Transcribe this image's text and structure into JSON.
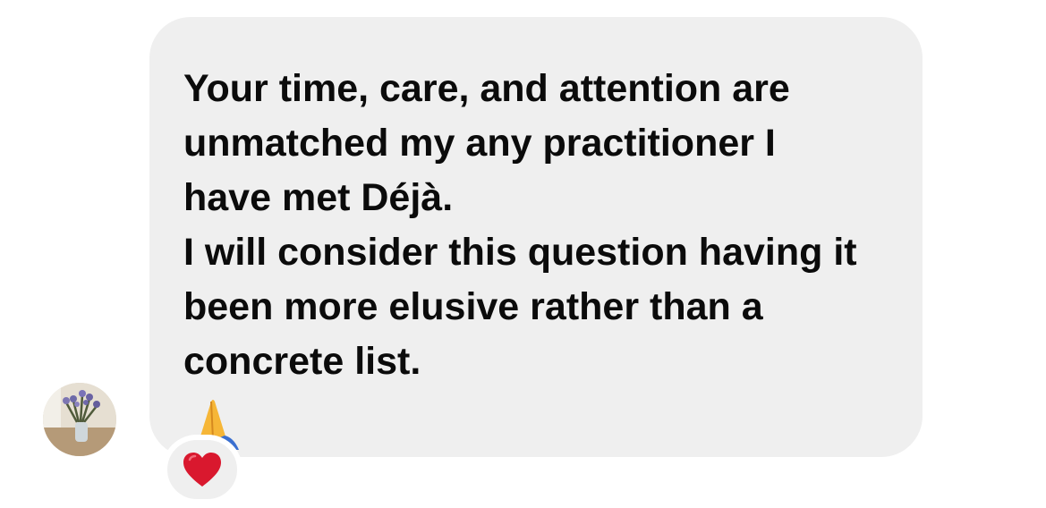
{
  "message": {
    "paragraph_1": "Your time, care, and attention are unmatched my any practitioner I have met Déjà.",
    "paragraph_2": "I will consider this question having it been more elusive rather than a concrete list.",
    "emoji_icon": "folded-hands-icon"
  },
  "sender": {
    "avatar_icon": "avatar-photo"
  },
  "reaction": {
    "icon": "red-heart-icon",
    "color": "#d9182e"
  },
  "colors": {
    "bubble_background": "#efefef",
    "text": "#0b0b0b",
    "page_background": "#ffffff"
  }
}
